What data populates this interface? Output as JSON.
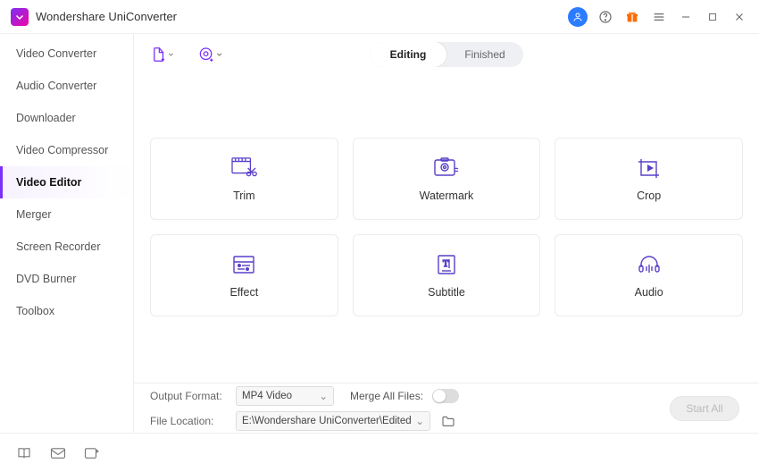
{
  "app": {
    "title": "Wondershare UniConverter"
  },
  "sidebar": {
    "items": [
      {
        "label": "Video Converter"
      },
      {
        "label": "Audio Converter"
      },
      {
        "label": "Downloader"
      },
      {
        "label": "Video Compressor"
      },
      {
        "label": "Video Editor"
      },
      {
        "label": "Merger"
      },
      {
        "label": "Screen Recorder"
      },
      {
        "label": "DVD Burner"
      },
      {
        "label": "Toolbox"
      }
    ],
    "active_index": 4
  },
  "tabs": {
    "editing": "Editing",
    "finished": "Finished",
    "active": "editing"
  },
  "tools": [
    {
      "key": "trim",
      "label": "Trim"
    },
    {
      "key": "watermark",
      "label": "Watermark"
    },
    {
      "key": "crop",
      "label": "Crop"
    },
    {
      "key": "effect",
      "label": "Effect"
    },
    {
      "key": "subtitle",
      "label": "Subtitle"
    },
    {
      "key": "audio",
      "label": "Audio"
    }
  ],
  "footer": {
    "output_format_label": "Output Format:",
    "output_format_value": "MP4 Video",
    "merge_label": "Merge All Files:",
    "merge_on": false,
    "file_location_label": "File Location:",
    "file_location_value": "E:\\Wondershare UniConverter\\Edited",
    "start_all": "Start All"
  }
}
